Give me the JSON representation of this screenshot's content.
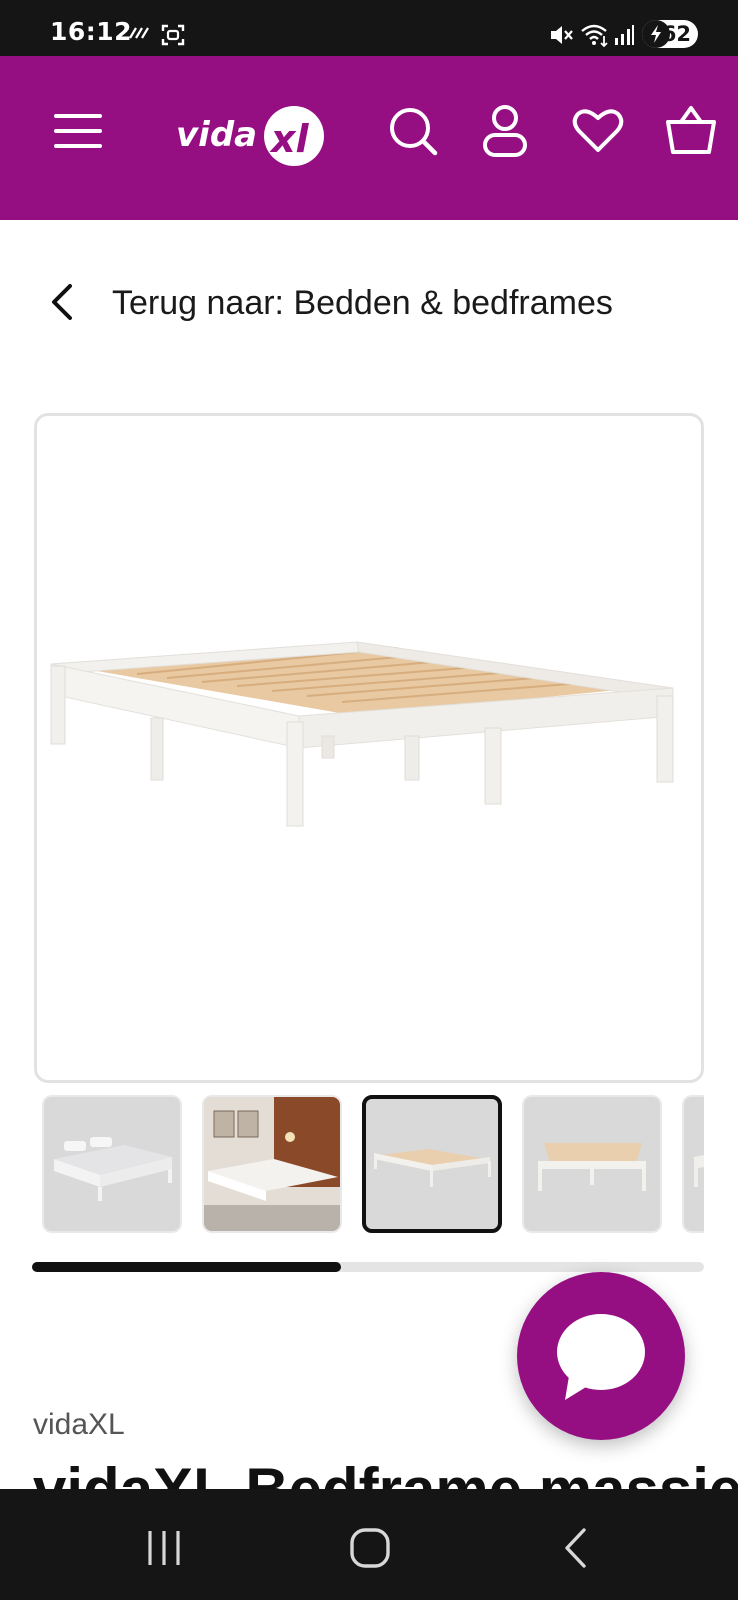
{
  "status_bar": {
    "time": "16:12",
    "battery": "62",
    "icons": [
      "screen-record-icon",
      "screenshot-icon",
      "mute-icon",
      "wifi-icon",
      "signal-icon",
      "battery-charging-icon"
    ]
  },
  "header": {
    "logo_text": "vidaXL",
    "icons": [
      "menu-icon",
      "search-icon",
      "account-icon",
      "wishlist-heart-icon",
      "cart-basket-icon"
    ],
    "background": "#960f82"
  },
  "back_link": {
    "label": "Terug naar: Bedden & bedframes"
  },
  "gallery": {
    "thumbnail_count_visible": 5,
    "active_thumbnail": 3,
    "scroll_progress": 0.46
  },
  "product": {
    "brand": "vidaXL",
    "title_partial": "vidaXL Bedframe massief"
  },
  "chat": {
    "icon": "chat-bubble-icon"
  },
  "nav_bar": {
    "icons": [
      "recents-icon",
      "home-icon",
      "back-icon"
    ]
  }
}
